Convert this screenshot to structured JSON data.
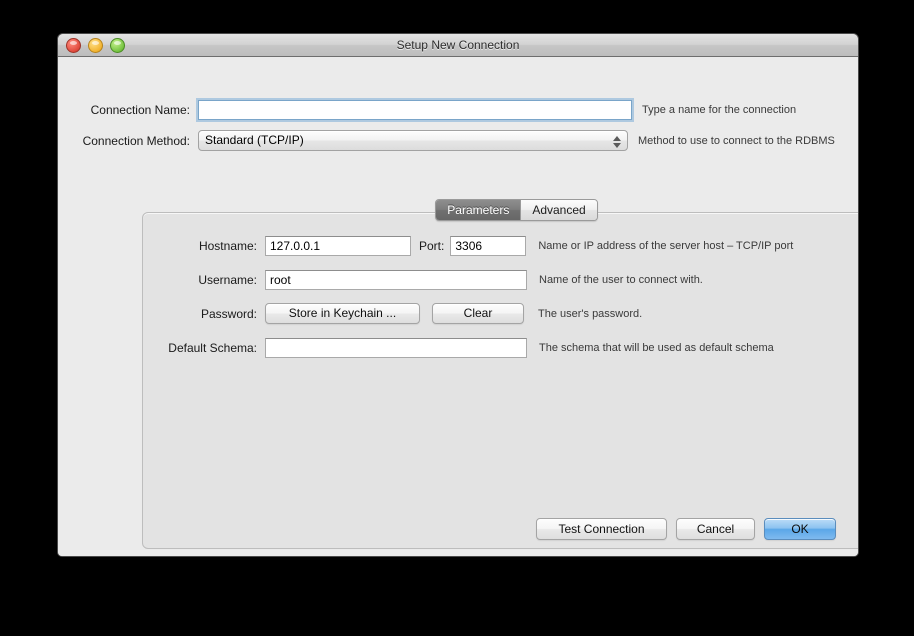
{
  "window": {
    "title": "Setup New Connection",
    "controls": [
      {
        "name": "close",
        "color": "#e0493c"
      },
      {
        "name": "minimize",
        "color": "#f2b430"
      },
      {
        "name": "zoom",
        "color": "#76c342"
      }
    ]
  },
  "form": {
    "connection_name": {
      "label": "Connection Name:",
      "value": "",
      "placeholder": "",
      "hint": "Type a name for the connection"
    },
    "connection_method": {
      "label": "Connection Method:",
      "value": "Standard (TCP/IP)",
      "hint": "Method to use to connect to the RDBMS",
      "options": [
        "Standard (TCP/IP)"
      ]
    }
  },
  "tabs": [
    {
      "label": "Parameters",
      "active": true
    },
    {
      "label": "Advanced",
      "active": false
    }
  ],
  "parameters": {
    "hostname": {
      "label": "Hostname:",
      "value": "127.0.0.1"
    },
    "port": {
      "label": "Port:",
      "value": "3306",
      "hint": "Name or IP address of the server host – TCP/IP port"
    },
    "username": {
      "label": "Username:",
      "value": "root",
      "hint": "Name of the user to connect with."
    },
    "password": {
      "label": "Password:",
      "store_button": "Store in Keychain ...",
      "clear_button": "Clear",
      "hint": "The user's password."
    },
    "default_schema": {
      "label": "Default Schema:",
      "value": "",
      "hint": "The schema that will be used as default schema"
    }
  },
  "footer": {
    "test_connection": "Test Connection",
    "cancel": "Cancel",
    "ok": "OK"
  },
  "colors": {
    "accent": "#5ba7e8",
    "window_bg": "#ebebeb",
    "panel_bg": "#e3e3e3"
  }
}
